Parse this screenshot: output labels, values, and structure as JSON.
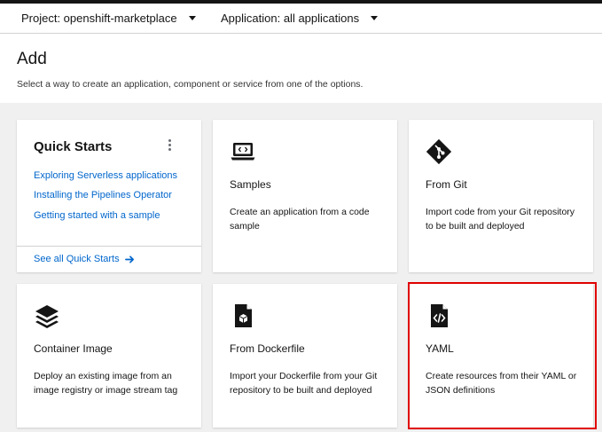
{
  "context": {
    "project_label": "Project: openshift-marketplace",
    "application_label": "Application: all applications"
  },
  "page": {
    "title": "Add",
    "description": "Select a way to create an application, component or service from one of the options."
  },
  "quick_starts": {
    "title": "Quick Starts",
    "links": [
      "Exploring Serverless applications",
      "Installing the Pipelines Operator",
      "Getting started with a sample"
    ],
    "see_all": "See all Quick Starts"
  },
  "tiles": [
    {
      "icon": "laptop-code-icon",
      "title": "Samples",
      "description": "Create an application from a code sample"
    },
    {
      "icon": "git-icon",
      "title": "From Git",
      "description": "Import code from your Git repository to be built and deployed"
    },
    {
      "icon": "layers-icon",
      "title": "Container Image",
      "description": "Deploy an existing image from an image registry or image stream tag"
    },
    {
      "icon": "dockerfile-icon",
      "title": "From Dockerfile",
      "description": "Import your Dockerfile from your Git repository to be built and deployed"
    },
    {
      "icon": "yaml-file-icon",
      "title": "YAML",
      "description": "Create resources from their YAML or JSON definitions"
    }
  ],
  "colors": {
    "link": "#0066cc",
    "highlight": "#e00000",
    "gallery_bg": "#f0f0f0"
  }
}
